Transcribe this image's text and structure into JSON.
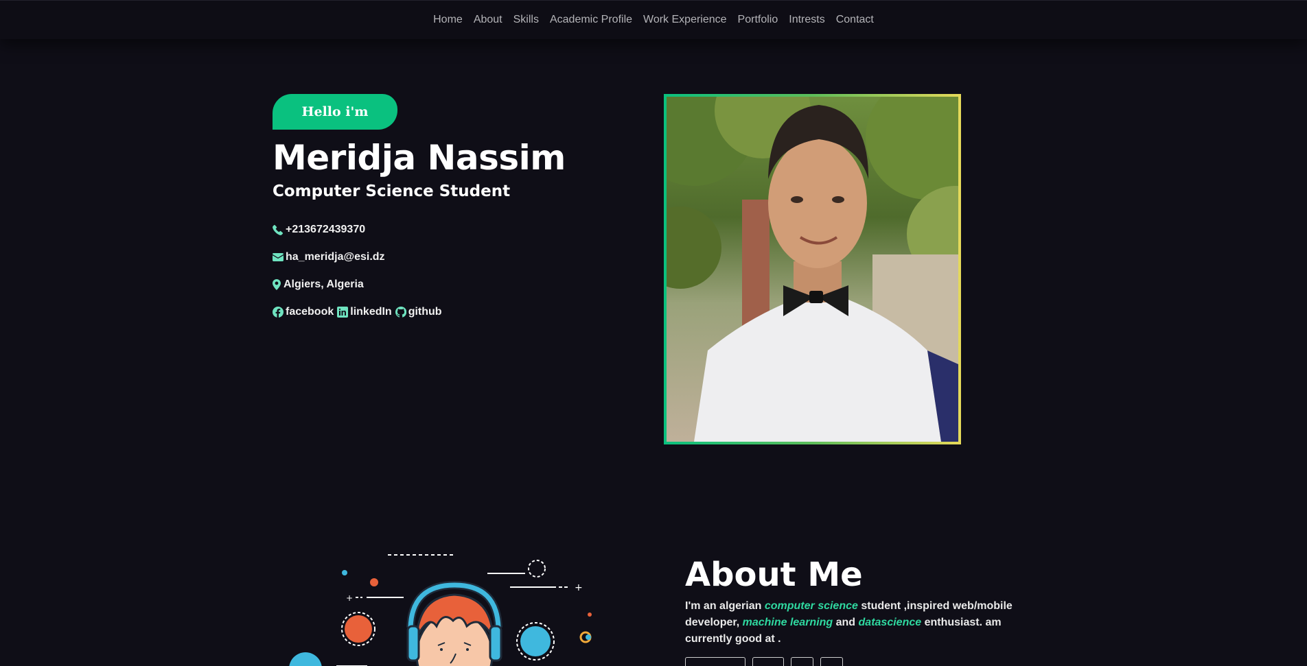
{
  "nav": {
    "items": [
      {
        "label": "Home"
      },
      {
        "label": "About"
      },
      {
        "label": "Skills"
      },
      {
        "label": "Academic Profile"
      },
      {
        "label": "Work Experience"
      },
      {
        "label": "Portfolio"
      },
      {
        "label": "Intrests"
      },
      {
        "label": "Contact"
      }
    ]
  },
  "hero": {
    "badge": "Hello i'm",
    "name": "Meridja Nassim",
    "title": "Computer Science Student",
    "phone": "+213672439370",
    "email": "ha_meridja@esi.dz",
    "location": "Algiers, Algeria",
    "social": {
      "facebook": "facebook",
      "linkedin": "linkedIn",
      "github": "github"
    }
  },
  "about": {
    "title": "About Me",
    "text_parts": {
      "p1": "I'm an algerian ",
      "h1": "computer science",
      "p2": " student ,inspired web/mobile developer, ",
      "h2": "machine learning",
      "p3": " and ",
      "h3": "datascience",
      "p4": " enthusiast. am currently good at ."
    }
  },
  "colors": {
    "background": "#0f0e17",
    "accent": "#0ac17f",
    "icon": "#6fe3c0",
    "highlight": "#2fd9a0"
  }
}
